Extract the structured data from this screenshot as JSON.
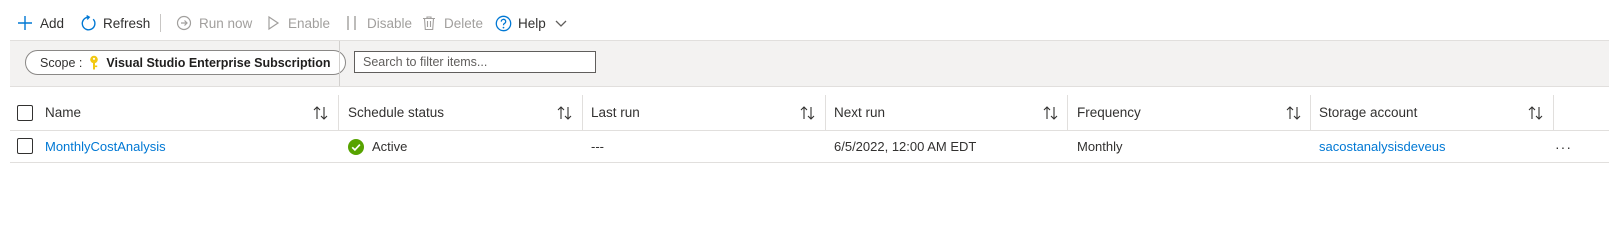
{
  "toolbar": {
    "add_label": "Add",
    "refresh_label": "Refresh",
    "run_now_label": "Run now",
    "enable_label": "Enable",
    "disable_label": "Disable",
    "delete_label": "Delete",
    "help_label": "Help"
  },
  "filter": {
    "scope_label": "Scope :",
    "scope_value": "Visual Studio Enterprise Subscription",
    "search_placeholder": "Search to filter items..."
  },
  "table": {
    "columns": [
      "Name",
      "Schedule status",
      "Last run",
      "Next run",
      "Frequency",
      "Storage account"
    ],
    "rows": [
      {
        "name": "MonthlyCostAnalysis",
        "schedule_status": "Active",
        "last_run": "---",
        "next_run": "6/5/2022, 12:00 AM EDT",
        "frequency": "Monthly",
        "storage_account": "sacostanalysisdeveus",
        "more": "···"
      }
    ]
  },
  "colors": {
    "accent": "#0078d4",
    "status_active": "#57a300",
    "key_icon": "#f2c811",
    "disabled_text": "#a19f9d"
  }
}
